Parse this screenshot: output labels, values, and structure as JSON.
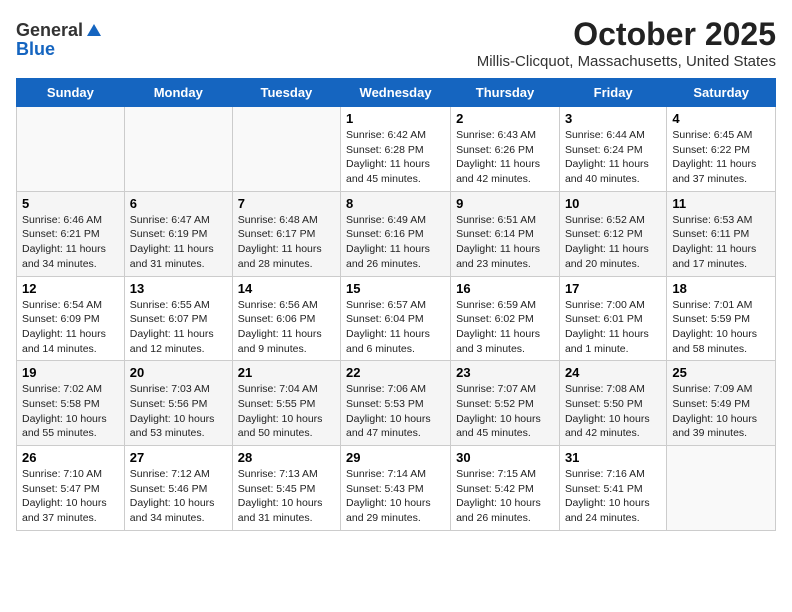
{
  "header": {
    "logo_general": "General",
    "logo_blue": "Blue",
    "month": "October 2025",
    "location": "Millis-Clicquot, Massachusetts, United States"
  },
  "days_of_week": [
    "Sunday",
    "Monday",
    "Tuesday",
    "Wednesday",
    "Thursday",
    "Friday",
    "Saturday"
  ],
  "weeks": [
    [
      {
        "num": "",
        "info": ""
      },
      {
        "num": "",
        "info": ""
      },
      {
        "num": "",
        "info": ""
      },
      {
        "num": "1",
        "info": "Sunrise: 6:42 AM\nSunset: 6:28 PM\nDaylight: 11 hours and 45 minutes."
      },
      {
        "num": "2",
        "info": "Sunrise: 6:43 AM\nSunset: 6:26 PM\nDaylight: 11 hours and 42 minutes."
      },
      {
        "num": "3",
        "info": "Sunrise: 6:44 AM\nSunset: 6:24 PM\nDaylight: 11 hours and 40 minutes."
      },
      {
        "num": "4",
        "info": "Sunrise: 6:45 AM\nSunset: 6:22 PM\nDaylight: 11 hours and 37 minutes."
      }
    ],
    [
      {
        "num": "5",
        "info": "Sunrise: 6:46 AM\nSunset: 6:21 PM\nDaylight: 11 hours and 34 minutes."
      },
      {
        "num": "6",
        "info": "Sunrise: 6:47 AM\nSunset: 6:19 PM\nDaylight: 11 hours and 31 minutes."
      },
      {
        "num": "7",
        "info": "Sunrise: 6:48 AM\nSunset: 6:17 PM\nDaylight: 11 hours and 28 minutes."
      },
      {
        "num": "8",
        "info": "Sunrise: 6:49 AM\nSunset: 6:16 PM\nDaylight: 11 hours and 26 minutes."
      },
      {
        "num": "9",
        "info": "Sunrise: 6:51 AM\nSunset: 6:14 PM\nDaylight: 11 hours and 23 minutes."
      },
      {
        "num": "10",
        "info": "Sunrise: 6:52 AM\nSunset: 6:12 PM\nDaylight: 11 hours and 20 minutes."
      },
      {
        "num": "11",
        "info": "Sunrise: 6:53 AM\nSunset: 6:11 PM\nDaylight: 11 hours and 17 minutes."
      }
    ],
    [
      {
        "num": "12",
        "info": "Sunrise: 6:54 AM\nSunset: 6:09 PM\nDaylight: 11 hours and 14 minutes."
      },
      {
        "num": "13",
        "info": "Sunrise: 6:55 AM\nSunset: 6:07 PM\nDaylight: 11 hours and 12 minutes."
      },
      {
        "num": "14",
        "info": "Sunrise: 6:56 AM\nSunset: 6:06 PM\nDaylight: 11 hours and 9 minutes."
      },
      {
        "num": "15",
        "info": "Sunrise: 6:57 AM\nSunset: 6:04 PM\nDaylight: 11 hours and 6 minutes."
      },
      {
        "num": "16",
        "info": "Sunrise: 6:59 AM\nSunset: 6:02 PM\nDaylight: 11 hours and 3 minutes."
      },
      {
        "num": "17",
        "info": "Sunrise: 7:00 AM\nSunset: 6:01 PM\nDaylight: 11 hours and 1 minute."
      },
      {
        "num": "18",
        "info": "Sunrise: 7:01 AM\nSunset: 5:59 PM\nDaylight: 10 hours and 58 minutes."
      }
    ],
    [
      {
        "num": "19",
        "info": "Sunrise: 7:02 AM\nSunset: 5:58 PM\nDaylight: 10 hours and 55 minutes."
      },
      {
        "num": "20",
        "info": "Sunrise: 7:03 AM\nSunset: 5:56 PM\nDaylight: 10 hours and 53 minutes."
      },
      {
        "num": "21",
        "info": "Sunrise: 7:04 AM\nSunset: 5:55 PM\nDaylight: 10 hours and 50 minutes."
      },
      {
        "num": "22",
        "info": "Sunrise: 7:06 AM\nSunset: 5:53 PM\nDaylight: 10 hours and 47 minutes."
      },
      {
        "num": "23",
        "info": "Sunrise: 7:07 AM\nSunset: 5:52 PM\nDaylight: 10 hours and 45 minutes."
      },
      {
        "num": "24",
        "info": "Sunrise: 7:08 AM\nSunset: 5:50 PM\nDaylight: 10 hours and 42 minutes."
      },
      {
        "num": "25",
        "info": "Sunrise: 7:09 AM\nSunset: 5:49 PM\nDaylight: 10 hours and 39 minutes."
      }
    ],
    [
      {
        "num": "26",
        "info": "Sunrise: 7:10 AM\nSunset: 5:47 PM\nDaylight: 10 hours and 37 minutes."
      },
      {
        "num": "27",
        "info": "Sunrise: 7:12 AM\nSunset: 5:46 PM\nDaylight: 10 hours and 34 minutes."
      },
      {
        "num": "28",
        "info": "Sunrise: 7:13 AM\nSunset: 5:45 PM\nDaylight: 10 hours and 31 minutes."
      },
      {
        "num": "29",
        "info": "Sunrise: 7:14 AM\nSunset: 5:43 PM\nDaylight: 10 hours and 29 minutes."
      },
      {
        "num": "30",
        "info": "Sunrise: 7:15 AM\nSunset: 5:42 PM\nDaylight: 10 hours and 26 minutes."
      },
      {
        "num": "31",
        "info": "Sunrise: 7:16 AM\nSunset: 5:41 PM\nDaylight: 10 hours and 24 minutes."
      },
      {
        "num": "",
        "info": ""
      }
    ]
  ]
}
